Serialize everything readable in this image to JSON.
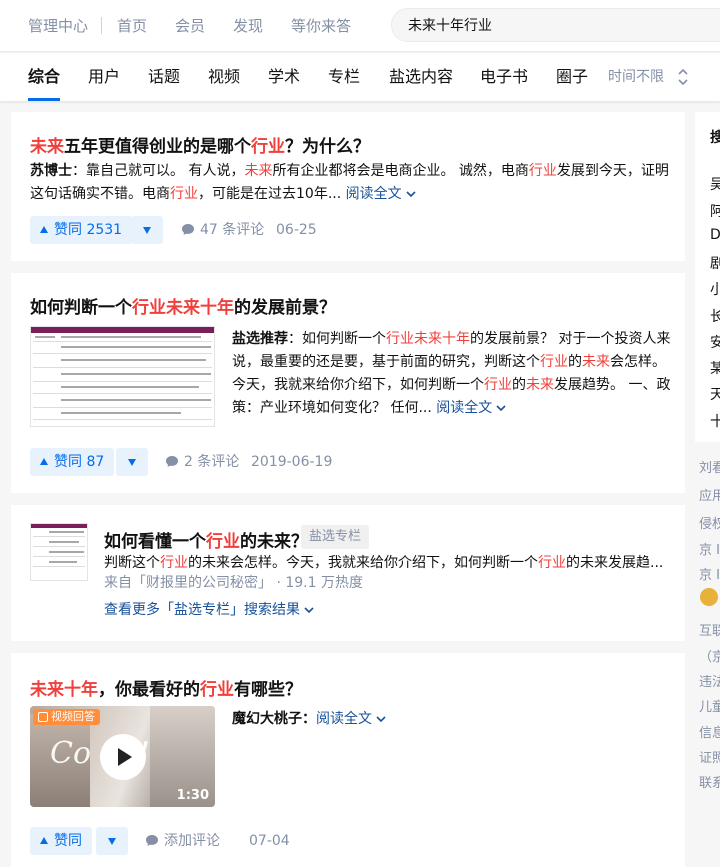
{
  "topnav": {
    "items": [
      "管理中心",
      "首页",
      "会员",
      "发现",
      "等你来答"
    ]
  },
  "search": {
    "value": "未来十年行业"
  },
  "tabs": [
    "综合",
    "用户",
    "话题",
    "视频",
    "学术",
    "专栏",
    "盐选内容",
    "电子书",
    "圈子"
  ],
  "tab_time": "时间不限",
  "cards": [
    {
      "title": [
        "未来",
        "五年更值得创业的是哪个",
        "行业",
        "？为什么？"
      ],
      "excerpt": [
        "苏博士",
        "：靠自己就可以。 有人说，",
        "未来",
        "所有企业都将会是电商企业。 诚然，电商",
        "行业",
        "发展到今天，证明这句话确实不错。电商",
        "行业",
        "，可能是在过去10年..."
      ],
      "read_more": "阅读全文",
      "vote_label": "赞同 2531",
      "comments": "47 条评论",
      "date": "06-25"
    },
    {
      "title": [
        "如何判断一个",
        "行业未来十年",
        "的发展前景？"
      ],
      "excerpt": [
        "盐选推荐",
        "：如何判断一个",
        "行业未来十年",
        "的发展前景？ 对于一个投资人来说，最重要的还是要，基于前面的研究，判断这个",
        "行业",
        "的",
        "未来",
        "会怎样。今天，我就来给你介绍下，如何判断一个",
        "行业",
        "的",
        "未来",
        "发展趋势。 一、政策：产业环境如何变化？ 任何..."
      ],
      "read_more": "阅读全文",
      "vote_label": "赞同 87",
      "comments": "2 条评论",
      "date": "2019-06-19"
    },
    {
      "title": [
        "如何看懂一个",
        "行业",
        "的未来？"
      ],
      "tag": "盐选专栏",
      "excerpt": [
        "判断这个",
        "行业",
        "的未来会怎样。今天，我就来给你介绍下，如何判断一个",
        "行业",
        "的未来发展趋..."
      ],
      "source": "来自「财报里的公司秘密」 · 19.1 万热度",
      "see_more": "查看更多「盐选专栏」搜索结果"
    },
    {
      "title": [
        "未来十年",
        "，你最看好的",
        "行业",
        "有哪些？"
      ],
      "video_badge": "视频回答",
      "video_duration": "1:30",
      "video_caption": "Co    on!",
      "author": "魔幻大桃子",
      "read_more": "阅读全文",
      "vote_label": "赞同",
      "comments": "添加评论",
      "date": "07-04"
    }
  ],
  "sidebar": {
    "list_chars": [
      "吴",
      "阿",
      "D",
      "剧",
      "小",
      "长",
      "安",
      "某",
      "天",
      "十"
    ],
    "header_char": "搜",
    "footer_lines": [
      "刘看",
      "应用",
      "侵权",
      "京 I",
      "京 I",
      "",
      "互联",
      "（京",
      "违法",
      "儿童",
      "信息",
      "证照",
      "联系"
    ]
  },
  "colors": {
    "highlight": "#f1403c",
    "accent": "#056de8",
    "link": "#175199"
  }
}
